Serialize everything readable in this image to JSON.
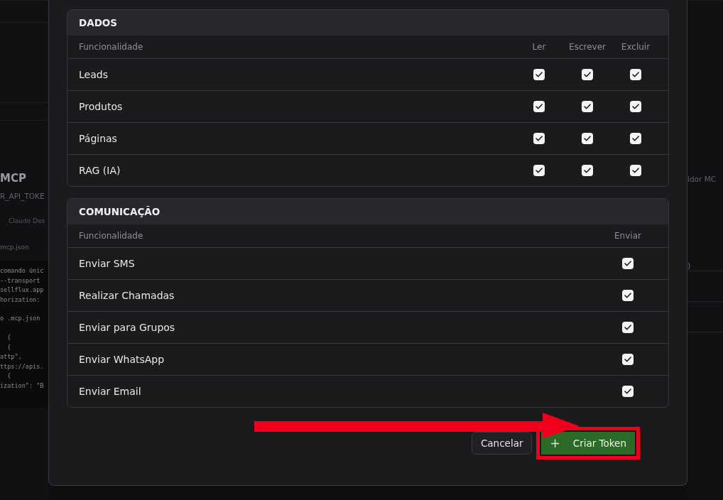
{
  "background": {
    "left_texts": [
      {
        "kind": "heading",
        "text": "MCP"
      },
      {
        "kind": "subtitle",
        "text": "R_API_TOKE"
      },
      {
        "kind": "tab",
        "text": "Claude Des"
      },
      {
        "kind": "file",
        "text": "mcp.json"
      }
    ],
    "code_blocks": [
      [
        "comando únic",
        "--transport",
        "sellflux.app",
        "horization:"
      ],
      [
        "o .mcp.json"
      ],
      [
        "  {",
        "  {",
        "attp\",",
        "ttps://apis.",
        "  {",
        "ization\": \"B"
      ]
    ],
    "right_texts": [
      {
        "kind": "subtitle",
        "text": "idor MC"
      },
      {
        "kind": "cell",
        "text": ")"
      }
    ]
  },
  "modal": {
    "sections": [
      {
        "title": "DADOS",
        "columns": [
          "Funcionalidade",
          "Ler",
          "Escrever",
          "Excluir"
        ],
        "rows": [
          {
            "name": "Leads",
            "permissions": [
              {
                "checked": true
              },
              {
                "checked": true
              },
              {
                "checked": true
              }
            ]
          },
          {
            "name": "Produtos",
            "permissions": [
              {
                "checked": true
              },
              {
                "checked": true
              },
              {
                "checked": true
              }
            ]
          },
          {
            "name": "Páginas",
            "permissions": [
              {
                "checked": true
              },
              {
                "checked": true
              },
              {
                "checked": true
              }
            ]
          },
          {
            "name": "RAG (IA)",
            "permissions": [
              {
                "checked": true
              },
              {
                "checked": true
              },
              {
                "checked": true
              }
            ]
          }
        ]
      },
      {
        "title": "COMUNICAÇÃO",
        "columns": [
          "Funcionalidade",
          "Enviar"
        ],
        "rows": [
          {
            "name": "Enviar SMS",
            "permissions": [
              {
                "checked": true
              }
            ]
          },
          {
            "name": "Realizar Chamadas",
            "permissions": [
              {
                "checked": true
              }
            ]
          },
          {
            "name": "Enviar para Grupos",
            "permissions": [
              {
                "checked": true
              }
            ]
          },
          {
            "name": "Enviar WhatsApp",
            "permissions": [
              {
                "checked": true
              }
            ]
          },
          {
            "name": "Enviar Email",
            "permissions": [
              {
                "checked": true
              }
            ]
          }
        ]
      }
    ],
    "buttons": [
      {
        "kind": "secondary",
        "label": "Cancelar",
        "highlighted": false
      },
      {
        "kind": "primary",
        "icon": "+",
        "label": "Criar Token",
        "highlighted": true
      }
    ]
  }
}
